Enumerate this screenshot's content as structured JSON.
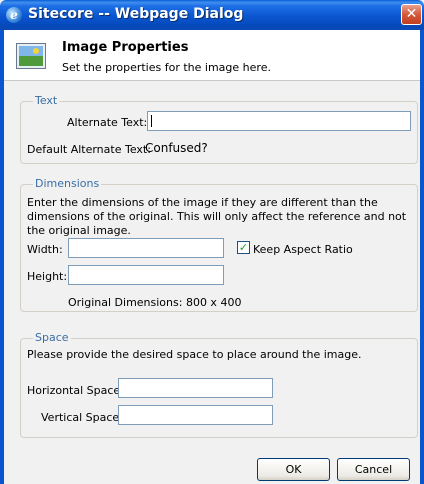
{
  "window": {
    "title": "Sitecore -- Webpage Dialog",
    "close_label": "✕"
  },
  "header": {
    "title": "Image Properties",
    "subtitle": "Set the properties for the image here."
  },
  "text_section": {
    "legend": "Text",
    "alt_label": "Alternate Text:",
    "alt_value": "",
    "default_alt_label": "Default Alternate Text:",
    "default_alt_value": "Confused?"
  },
  "dimensions_section": {
    "legend": "Dimensions",
    "description": "Enter the dimensions of the image if they are different than the dimensions of the original. This will only affect the reference and not the original image.",
    "width_label": "Width:",
    "width_value": "",
    "height_label": "Height:",
    "height_value": "",
    "keep_aspect_label": "Keep Aspect Ratio",
    "keep_aspect_checked": true,
    "original_dimensions": "Original Dimensions: 800 x 400"
  },
  "space_section": {
    "legend": "Space",
    "description": "Please provide the desired space to place around the image.",
    "horizontal_label": "Horizontal Space:",
    "horizontal_value": "",
    "vertical_label": "Vertical Space:",
    "vertical_value": ""
  },
  "buttons": {
    "ok_label": "OK",
    "cancel_label": "Cancel"
  }
}
